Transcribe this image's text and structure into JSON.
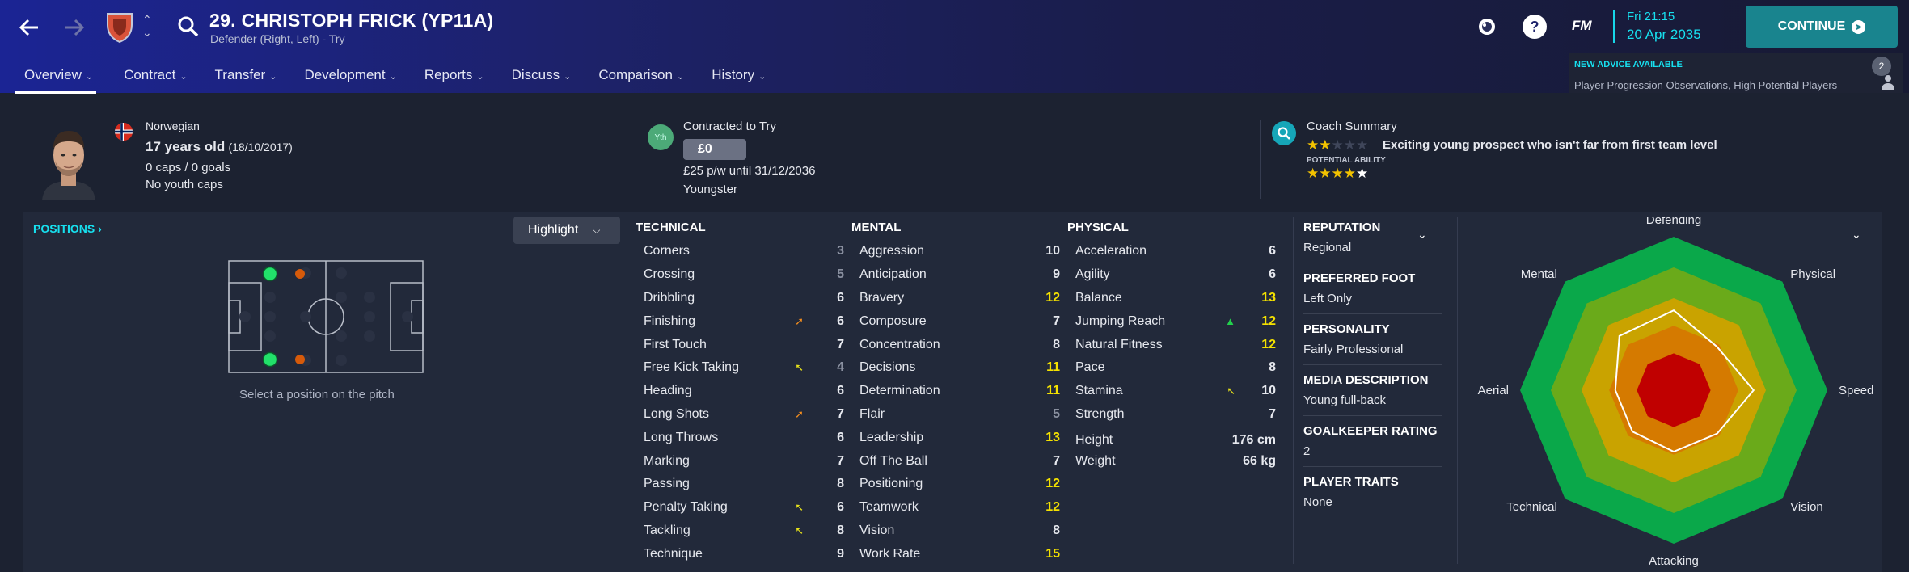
{
  "header": {
    "title": "29. CHRISTOPH FRICK (YP11A)",
    "subtitle": "Defender (Right, Left) - Try",
    "tabs": [
      "Overview",
      "Contract",
      "Transfer",
      "Development",
      "Reports",
      "Discuss",
      "Comparison",
      "History"
    ],
    "fm_label": "FM",
    "time": "Fri 21:15",
    "date": "20 Apr 2035",
    "continue_label": "CONTINUE",
    "advice_heading": "NEW ADVICE AVAILABLE",
    "advice_text": "Player Progression Observations, High Potential Players",
    "advice_count": "2"
  },
  "bio": {
    "nationality": "Norwegian",
    "age": "17 years old",
    "dob": "(18/10/2017)",
    "caps": "0 caps / 0 goals",
    "youth_caps": "No youth caps"
  },
  "contract": {
    "heading": "Contracted to Try",
    "badge": "Yth",
    "fee": "£0",
    "wage": "£25 p/w until 31/12/2036",
    "type": "Youngster"
  },
  "coach": {
    "heading": "Coach Summary",
    "summary": "Exciting young prospect who isn't far from first team level",
    "potential_label": "POTENTIAL ABILITY",
    "current_stars": 2,
    "potential_stars": 4
  },
  "positions": {
    "title": "POSITIONS",
    "highlight_label": "Highlight",
    "caption": "Select a position on the pitch"
  },
  "technical": {
    "heading": "TECHNICAL",
    "items": [
      {
        "name": "Corners",
        "value": "3",
        "arrow": ""
      },
      {
        "name": "Crossing",
        "value": "5",
        "arrow": ""
      },
      {
        "name": "Dribbling",
        "value": "6",
        "arrow": ""
      },
      {
        "name": "Finishing",
        "value": "6",
        "arrow": "orange"
      },
      {
        "name": "First Touch",
        "value": "7",
        "arrow": ""
      },
      {
        "name": "Free Kick Taking",
        "value": "4",
        "arrow": "yellow"
      },
      {
        "name": "Heading",
        "value": "6",
        "arrow": ""
      },
      {
        "name": "Long Shots",
        "value": "7",
        "arrow": "orange"
      },
      {
        "name": "Long Throws",
        "value": "6",
        "arrow": ""
      },
      {
        "name": "Marking",
        "value": "7",
        "arrow": ""
      },
      {
        "name": "Passing",
        "value": "8",
        "arrow": ""
      },
      {
        "name": "Penalty Taking",
        "value": "6",
        "arrow": "yellow"
      },
      {
        "name": "Tackling",
        "value": "8",
        "arrow": "yellow"
      },
      {
        "name": "Technique",
        "value": "9",
        "arrow": ""
      }
    ]
  },
  "mental": {
    "heading": "MENTAL",
    "items": [
      {
        "name": "Aggression",
        "value": "10"
      },
      {
        "name": "Anticipation",
        "value": "9"
      },
      {
        "name": "Bravery",
        "value": "12"
      },
      {
        "name": "Composure",
        "value": "7"
      },
      {
        "name": "Concentration",
        "value": "8"
      },
      {
        "name": "Decisions",
        "value": "11"
      },
      {
        "name": "Determination",
        "value": "11"
      },
      {
        "name": "Flair",
        "value": "5"
      },
      {
        "name": "Leadership",
        "value": "13"
      },
      {
        "name": "Off The Ball",
        "value": "7"
      },
      {
        "name": "Positioning",
        "value": "12"
      },
      {
        "name": "Teamwork",
        "value": "12"
      },
      {
        "name": "Vision",
        "value": "8"
      },
      {
        "name": "Work Rate",
        "value": "15"
      }
    ]
  },
  "physical": {
    "heading": "PHYSICAL",
    "items": [
      {
        "name": "Acceleration",
        "value": "6",
        "arrow": ""
      },
      {
        "name": "Agility",
        "value": "6",
        "arrow": ""
      },
      {
        "name": "Balance",
        "value": "13",
        "arrow": ""
      },
      {
        "name": "Jumping Reach",
        "value": "12",
        "arrow": "green"
      },
      {
        "name": "Natural Fitness",
        "value": "12",
        "arrow": ""
      },
      {
        "name": "Pace",
        "value": "8",
        "arrow": ""
      },
      {
        "name": "Stamina",
        "value": "10",
        "arrow": "yellow"
      },
      {
        "name": "Strength",
        "value": "7",
        "arrow": ""
      }
    ],
    "height_label": "Height",
    "height": "176 cm",
    "weight_label": "Weight",
    "weight": "66 kg"
  },
  "profile": [
    {
      "heading": "REPUTATION",
      "value": "Regional"
    },
    {
      "heading": "PREFERRED FOOT",
      "value": "Left Only"
    },
    {
      "heading": "PERSONALITY",
      "value": "Fairly Professional"
    },
    {
      "heading": "MEDIA DESCRIPTION",
      "value": "Young full-back"
    },
    {
      "heading": "GOALKEEPER RATING",
      "value": "2"
    },
    {
      "heading": "PLAYER TRAITS",
      "value": "None"
    }
  ],
  "radar": {
    "labels": [
      "Defending",
      "Physical",
      "Speed",
      "Vision",
      "Attacking",
      "Technical",
      "Aerial",
      "Mental"
    ],
    "values": [
      0.52,
      0.4,
      0.52,
      0.4,
      0.4,
      0.38,
      0.38,
      0.5
    ],
    "colors": {
      "ring5": "#0aa84a",
      "ring4": "#6aaa1a",
      "ring3": "#c9a300",
      "ring2": "#d57a00",
      "ring1": "#c82a00",
      "core": "#c00000"
    }
  },
  "colors": {
    "accent": "#17e0ef",
    "attr_high": "#f4e100",
    "attr_mid": "#e6e8ee",
    "attr_low": "#8a90a0",
    "arrow_orange": "#f28c1e",
    "arrow_yellow": "#e7e21a",
    "arrow_green": "#22d04c"
  }
}
